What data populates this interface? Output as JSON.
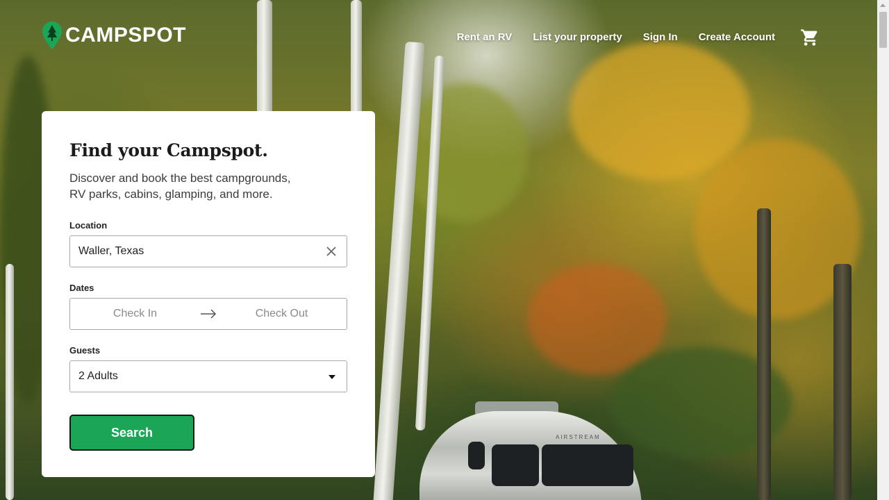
{
  "brand": {
    "name": "CAMPSPOT",
    "accent": "#1aa656"
  },
  "nav": {
    "items": [
      {
        "label": "Rent an RV"
      },
      {
        "label": "List your property"
      },
      {
        "label": "Sign In"
      },
      {
        "label": "Create Account"
      }
    ],
    "cart_icon": "shopping-cart-icon"
  },
  "search_card": {
    "title": "Find your Campspot.",
    "description": "Discover and book the best campgrounds, RV parks, cabins, glamping, and more.",
    "location": {
      "label": "Location",
      "value": "Waller, Texas",
      "clear_icon": "close-icon"
    },
    "dates": {
      "label": "Dates",
      "check_in_placeholder": "Check In",
      "check_out_placeholder": "Check Out",
      "arrow_icon": "arrow-right-icon"
    },
    "guests": {
      "label": "Guests",
      "value": "2 Adults",
      "caret_icon": "caret-down-icon"
    },
    "search_button": "Search"
  },
  "background": {
    "trailer_text": "AIRSTREAM"
  }
}
